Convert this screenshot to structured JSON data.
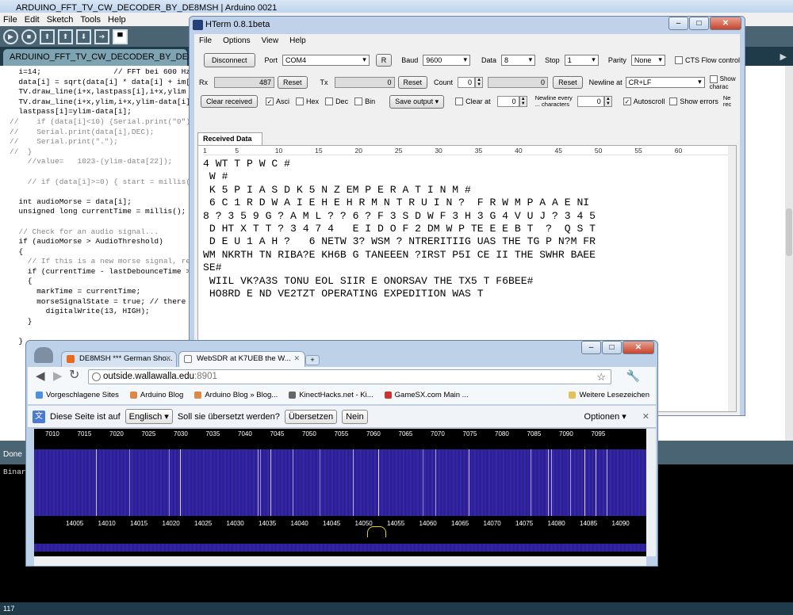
{
  "arduino": {
    "title": "ARDUINO_FFT_TV_CW_DECODER_BY_DE8MSH | Arduino 0021",
    "menu": [
      "File",
      "Edit",
      "Sketch",
      "Tools",
      "Help"
    ],
    "tab": "ARDUINO_FFT_TV_CW_DECODER_BY_DE8MSH",
    "code_lines": [
      "  i=14;                // FFT bei 600 Hz",
      "  data[i] = sqrt(data[i] * data[i] + im[i]",
      "  TV.draw_line(i+x,lastpass[i],i+x,ylim",
      "  TV.draw_line(i+x,ylim,i+x,ylim-data[i]",
      "  lastpass[i]=ylim-data[i];",
      "//    if (data[i]<10) {Serial.print(\"0\");}",
      "//    Serial.print(data[i],DEC);",
      "//    Serial.print(\".\");",
      "//  }",
      "    //value=   1023-(ylim-data[22]);",
      "",
      "    // if (data[i]>=0) { start = millis();",
      "",
      "  int audioMorse = data[i];",
      "  unsigned long currentTime = millis();",
      "",
      "  // Check for an audio signal...",
      "  if (audioMorse > AudioThreshold)",
      "  {",
      "    // If this is a new morse signal, reset",
      "    if (currentTime - lastDebounceTime >",
      "    {",
      "      markTime = currentTime;",
      "      morseSignalState = true; // there is",
      "        digitalWrite(13, HIGH);",
      "    }",
      "",
      "  }"
    ],
    "status": "Done",
    "console": "Binar",
    "footer": "117"
  },
  "hterm": {
    "title": "HTerm 0.8.1beta",
    "menu": [
      "File",
      "Options",
      "View",
      "Help"
    ],
    "disconnect": "Disconnect",
    "port_label": "Port",
    "port_value": "COM4",
    "r_btn": "R",
    "baud_label": "Baud",
    "baud_value": "9600",
    "data_label": "Data",
    "data_value": "8",
    "stop_label": "Stop",
    "stop_value": "1",
    "parity_label": "Parity",
    "parity_value": "None",
    "cts_label": "CTS Flow control",
    "rx_label": "Rx",
    "rx_value": "487",
    "reset1": "Reset",
    "tx_label": "Tx",
    "tx_value": "0",
    "reset2": "Reset",
    "count_label": "Count",
    "count_value": "0",
    "count_field": "0",
    "reset3": "Reset",
    "newline_label": "Newline at",
    "newline_value": "CR+LF",
    "show_label": "Show",
    "show_label2": "charac",
    "clear_received": "Clear received",
    "asci": "Asci",
    "hex": "Hex",
    "dec": "Dec",
    "bin": "Bin",
    "save_output": "Save output",
    "clear_at": "Clear at",
    "clear_at_value": "0",
    "newline_every1": "Newline every",
    "newline_every2": "... characters",
    "newline_every_value": "0",
    "autoscroll": "Autoscroll",
    "show_errors": "Show errors",
    "ne_label": "Ne",
    "ne_label2": "rec",
    "received_tab": "Received Data",
    "ruler": [
      "1",
      "5",
      "10",
      "15",
      "20",
      "25",
      "30",
      "35",
      "40",
      "45",
      "50",
      "55",
      "60"
    ],
    "received_lines": [
      "4 WT T P W C #",
      " W #",
      " K 5 P I A S D K 5 N Z EM P E R A T I N M #",
      " 6 C 1 R D W A I E H E H R M N T R U I N ?  F R W M P A A E NI",
      "8 ? 3 5 9 G ? A M L ? ? 6 ? F 3 S D W F 3 H 3 G 4 V U J ? 3 4 5",
      " D HT X T T ? 3 4 7 4   E I D O F 2 DM W P TE E E B T  ?  Q S T",
      " D E U 1 A H ?   6 NETW 3? WSM ? NTRERITIIG UAS THE TG P N?M FR",
      "WM NKRTH TN RIBA?E KH6B G TANEEEN ?IRST P5I CE II THE SWHR BAEE",
      "SE#",
      " WIIL VK?A3S TONU EOL SIIR E ONORSAV THE TX5 T F6BEE#",
      " HO8RD E ND VE2TZT OPERATING EXPEDITION WAS T"
    ]
  },
  "chrome": {
    "tab1": "DE8MSH *** German Sho...",
    "tab2": "WebSDR at K7UEB the W...",
    "url_host": "outside.wallawalla.edu",
    "url_port": ":8901",
    "bookmarks": [
      "Vorgeschlagene Sites",
      "Arduino Blog",
      "Arduino Blog » Blog...",
      "KinectHacks.net - Ki...",
      "GameSX.com Main ...",
      "Weitere Lesezeichen"
    ],
    "translate_prompt": "Diese Seite ist auf",
    "lang": "Englisch",
    "translate_q": "Soll sie übersetzt werden?",
    "translate_btn": "Übersetzen",
    "no_btn": "Nein",
    "options": "Optionen",
    "top_ticks": [
      "7010",
      "7015",
      "7020",
      "7025",
      "7030",
      "7035",
      "7040",
      "7045",
      "7050",
      "7055",
      "7060",
      "7065",
      "7070",
      "7075",
      "7080",
      "7085",
      "7090",
      "7095"
    ],
    "bottom_ticks": [
      "14005",
      "14010",
      "14015",
      "14020",
      "14025",
      "14030",
      "14035",
      "14040",
      "14045",
      "14050",
      "14055",
      "14060",
      "14065",
      "14070",
      "14075",
      "14080",
      "14085",
      "14090"
    ]
  }
}
